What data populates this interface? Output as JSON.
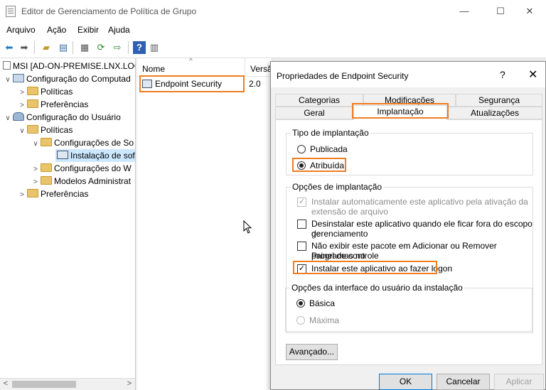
{
  "window": {
    "title": "Editor de Gerenciamento de Política de Grupo",
    "minimize": "—",
    "maximize": "☐",
    "close": "✕"
  },
  "menu": [
    "Arquivo",
    "Ação",
    "Exibir",
    "Ajuda"
  ],
  "toolbar_icons": [
    "back-icon",
    "forward-icon",
    "up-folder-icon",
    "show-hide-tree-icon",
    "properties-icon",
    "refresh-icon",
    "export-icon",
    "help-icon",
    "view-icon"
  ],
  "tree": {
    "root": "MSI [AD-ON-PREMISE.LNX.LOC",
    "computer_config": "Configuração do Computad",
    "cc_policies": "Políticas",
    "cc_preferences": "Preferências",
    "user_config": "Configuração do Usuário",
    "uc_policies": "Políticas",
    "software_settings": "Configurações de So",
    "software_install": "Instalação de soft",
    "windows_settings": "Configurações do W",
    "admin_templates": "Modelos Administrat",
    "uc_preferences": "Preferências"
  },
  "list": {
    "col_name": "Nome",
    "col_version": "Versão",
    "rows": [
      {
        "name": "Endpoint Security",
        "version": "2.0"
      }
    ]
  },
  "dialog": {
    "title": "Propriedades de Endpoint Security",
    "help": "?",
    "close": "✕",
    "tabs_row1": [
      "Categorias",
      "Modificações",
      "Segurança"
    ],
    "tabs_row2": [
      "Geral",
      "Implantação",
      "Atualizações"
    ],
    "active_tab": "Implantação",
    "deploy_type": {
      "legend": "Tipo de implantação",
      "published": "Publicada",
      "assigned": "Atribuída",
      "selected": "Atribuída"
    },
    "deploy_options": {
      "legend": "Opções de implantação",
      "auto_install_l1": "Instalar automaticamente este aplicativo pela ativação da",
      "auto_install_l2": "extensão de arquivo",
      "auto_install_checked": true,
      "uninstall_l1": "Desinstalar este aplicativo quando ele ficar fora do escopo de",
      "uninstall_l2": "gerenciamento",
      "uninstall_checked": false,
      "hide_l1": "Não exibir este pacote em Adicionar ou Remover Programas no",
      "hide_l2": "painel de controle",
      "hide_checked": false,
      "install_logon": "Instalar este aplicativo ao fazer logon",
      "install_logon_checked": true
    },
    "ui_options": {
      "legend": "Opções da interface do usuário da instalação",
      "basic": "Básica",
      "max": "Máxima",
      "selected": "Básica"
    },
    "advanced_button": "Avançado...",
    "ok": "OK",
    "cancel": "Cancelar",
    "apply": "Aplicar"
  },
  "accent_color": "#ef7d22"
}
